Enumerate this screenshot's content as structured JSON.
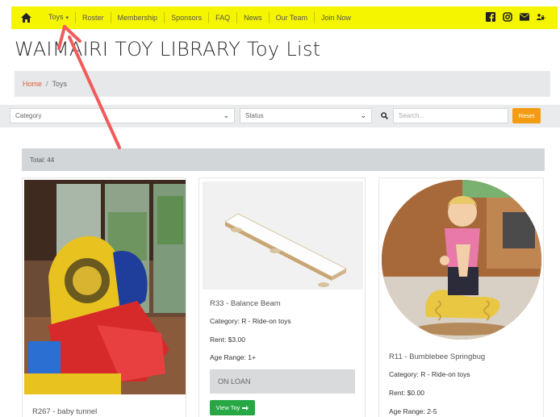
{
  "nav": {
    "items": [
      {
        "label": "Toys",
        "has_caret": true
      },
      {
        "label": "Roster"
      },
      {
        "label": "Membership"
      },
      {
        "label": "Sponsors"
      },
      {
        "label": "FAQ"
      },
      {
        "label": "News"
      },
      {
        "label": "Our Team"
      },
      {
        "label": "Join Now"
      }
    ],
    "caret": "▾",
    "bg_color": "#f5f500",
    "social_icons": [
      "facebook-icon",
      "instagram-icon",
      "mail-icon",
      "user-lock-icon"
    ]
  },
  "page": {
    "title": "WAIMAIRI TOY LIBRARY Toy List"
  },
  "breadcrumb": {
    "home": "Home",
    "separator": "/",
    "current": "Toys"
  },
  "filters": {
    "category_value": "Category",
    "status_value": "Status",
    "search_placeholder": "Search...",
    "reset_label": "Reset",
    "reset_color": "#f39c12"
  },
  "results": {
    "total_label": "Total: 44"
  },
  "cards": [
    {
      "title": "R267 - baby tunnel"
    },
    {
      "title": "R33 - Balance Beam",
      "category": "Category: R - Ride-on toys",
      "rent": "Rent: $3.00",
      "age": "Age Range: 1+",
      "status": "ON LOAN",
      "button": "View Toy",
      "button_color": "#28a745"
    },
    {
      "title": "R11 - Bumblebee Springbug",
      "category": "Category: R - Ride-on toys",
      "rent": "Rent: $0.00",
      "age": "Age Range: 2-5"
    }
  ],
  "annotation": {
    "color": "#f15b5b"
  }
}
